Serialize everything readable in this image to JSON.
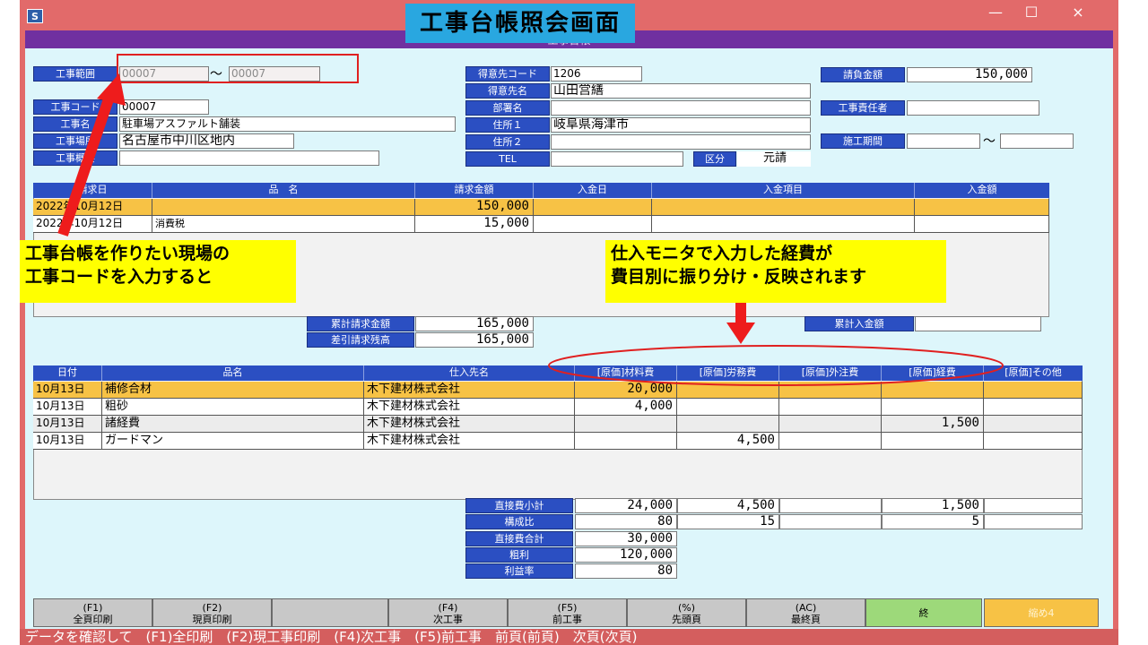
{
  "window": {
    "caption": "工事台帳照会画面",
    "sub_title": "工事台帳",
    "controls": {
      "minimize": "—",
      "maximize": "☐",
      "close": "×"
    }
  },
  "header": {
    "range_label": "工事範囲",
    "range_from": "00007",
    "range_sep": "～",
    "range_to": "00007",
    "code_label": "工事コード",
    "code_value": "00007",
    "name_label": "工事名",
    "name_value": "駐車場アスファルト舗装",
    "site_label": "工事場所",
    "site_value": "名古屋市中川区地内",
    "summary_label": "工事概要",
    "summary_value": "",
    "client_code_label": "得意先コード",
    "client_code_value": "1206",
    "client_name_label": "得意先名",
    "client_name_value": "山田営繕",
    "dept_label": "部署名",
    "dept_value": "",
    "addr1_label": "住所１",
    "addr1_value": "岐阜県海津市",
    "addr2_label": "住所２",
    "addr2_value": "",
    "tel_label": "TEL",
    "tel_value": "",
    "kubun_label": "区分",
    "kubun_value": "元請",
    "contract_label": "請負金額",
    "contract_value": "150,000",
    "manager_label": "工事責任者",
    "manager_value": "",
    "period_label": "施工期間",
    "period_sep": "～"
  },
  "billing": {
    "columns": [
      "請求日",
      "品　名",
      "請求金額",
      "入金日",
      "入金項目",
      "入金額"
    ],
    "rows": [
      {
        "date": "2022年10月12日",
        "item": "",
        "amount": "150,000",
        "pay_date": "",
        "pay_item": "",
        "pay_amount": ""
      },
      {
        "date": "2022年10月12日",
        "item": "消費税",
        "amount": "15,000",
        "pay_date": "",
        "pay_item": "",
        "pay_amount": ""
      }
    ],
    "total_label": "累計請求金額",
    "total_value": "165,000",
    "balance_label": "差引請求残高",
    "balance_value": "165,000",
    "received_label": "累計入金額",
    "received_value": ""
  },
  "purchases": {
    "columns": [
      "日付",
      "品名",
      "仕入先名",
      "[原価]材料費",
      "[原価]労務費",
      "[原価]外注費",
      "[原価]経費",
      "[原価]その他"
    ],
    "rows": [
      {
        "date": "10月13日",
        "item": "補修合材",
        "vendor": "木下建材株式会社",
        "material": "20,000",
        "labor": "",
        "outsource": "",
        "expense": "",
        "other": ""
      },
      {
        "date": "10月13日",
        "item": "粗砂",
        "vendor": "木下建材株式会社",
        "material": "4,000",
        "labor": "",
        "outsource": "",
        "expense": "",
        "other": ""
      },
      {
        "date": "10月13日",
        "item": "諸経費",
        "vendor": "木下建材株式会社",
        "material": "",
        "labor": "",
        "outsource": "",
        "expense": "1,500",
        "other": ""
      },
      {
        "date": "10月13日",
        "item": "ガードマン",
        "vendor": "木下建材株式会社",
        "material": "",
        "labor": "4,500",
        "outsource": "",
        "expense": "",
        "other": ""
      }
    ],
    "subtotal_label": "直接費小計",
    "subtotal": {
      "material": "24,000",
      "labor": "4,500",
      "outsource": "",
      "expense": "1,500",
      "other": ""
    },
    "ratio_label": "構成比",
    "ratio": {
      "material": "80",
      "labor": "15",
      "outsource": "",
      "expense": "5",
      "other": ""
    },
    "total_label": "直接費合計",
    "total_value": "30,000",
    "profit_label": "粗利",
    "profit_value": "120,000",
    "margin_label": "利益率",
    "margin_value": "80"
  },
  "annotations": {
    "left_note_line1": "工事台帳を作りたい現場の",
    "left_note_line2": "工事コードを入力すると",
    "right_note_line1": "仕入モニタで入力した経費が",
    "right_note_line2": "費目別に振り分け・反映されます"
  },
  "fkeys": [
    {
      "key": "(F1)",
      "label": "全頁印刷"
    },
    {
      "key": "(F2)",
      "label": "現頁印刷"
    },
    {
      "key": "",
      "label": ""
    },
    {
      "key": "(F4)",
      "label": "次工事"
    },
    {
      "key": "(F5)",
      "label": "前工事"
    },
    {
      "key": "(%)",
      "label": "先頭頁"
    },
    {
      "key": "(AC)",
      "label": "最終頁"
    },
    {
      "key": "",
      "label": "終"
    },
    {
      "key": "",
      "label": "縮め4"
    }
  ],
  "status_text": "データを確認して　(F1)全印刷　(F2)現工事印刷　(F4)次工事　(F5)前工事　前頁(前頁)　次頁(次頁)",
  "colors": {
    "accent": "#2b4fc2",
    "highlight_row": "#f7c245",
    "title_bar": "#e26a6a",
    "sub_bar": "#7030a0",
    "caption_bg": "#29a7e0",
    "note_bg": "#ffff00",
    "exit_key": "#9dd97a",
    "ext_key": "#f7c245"
  }
}
